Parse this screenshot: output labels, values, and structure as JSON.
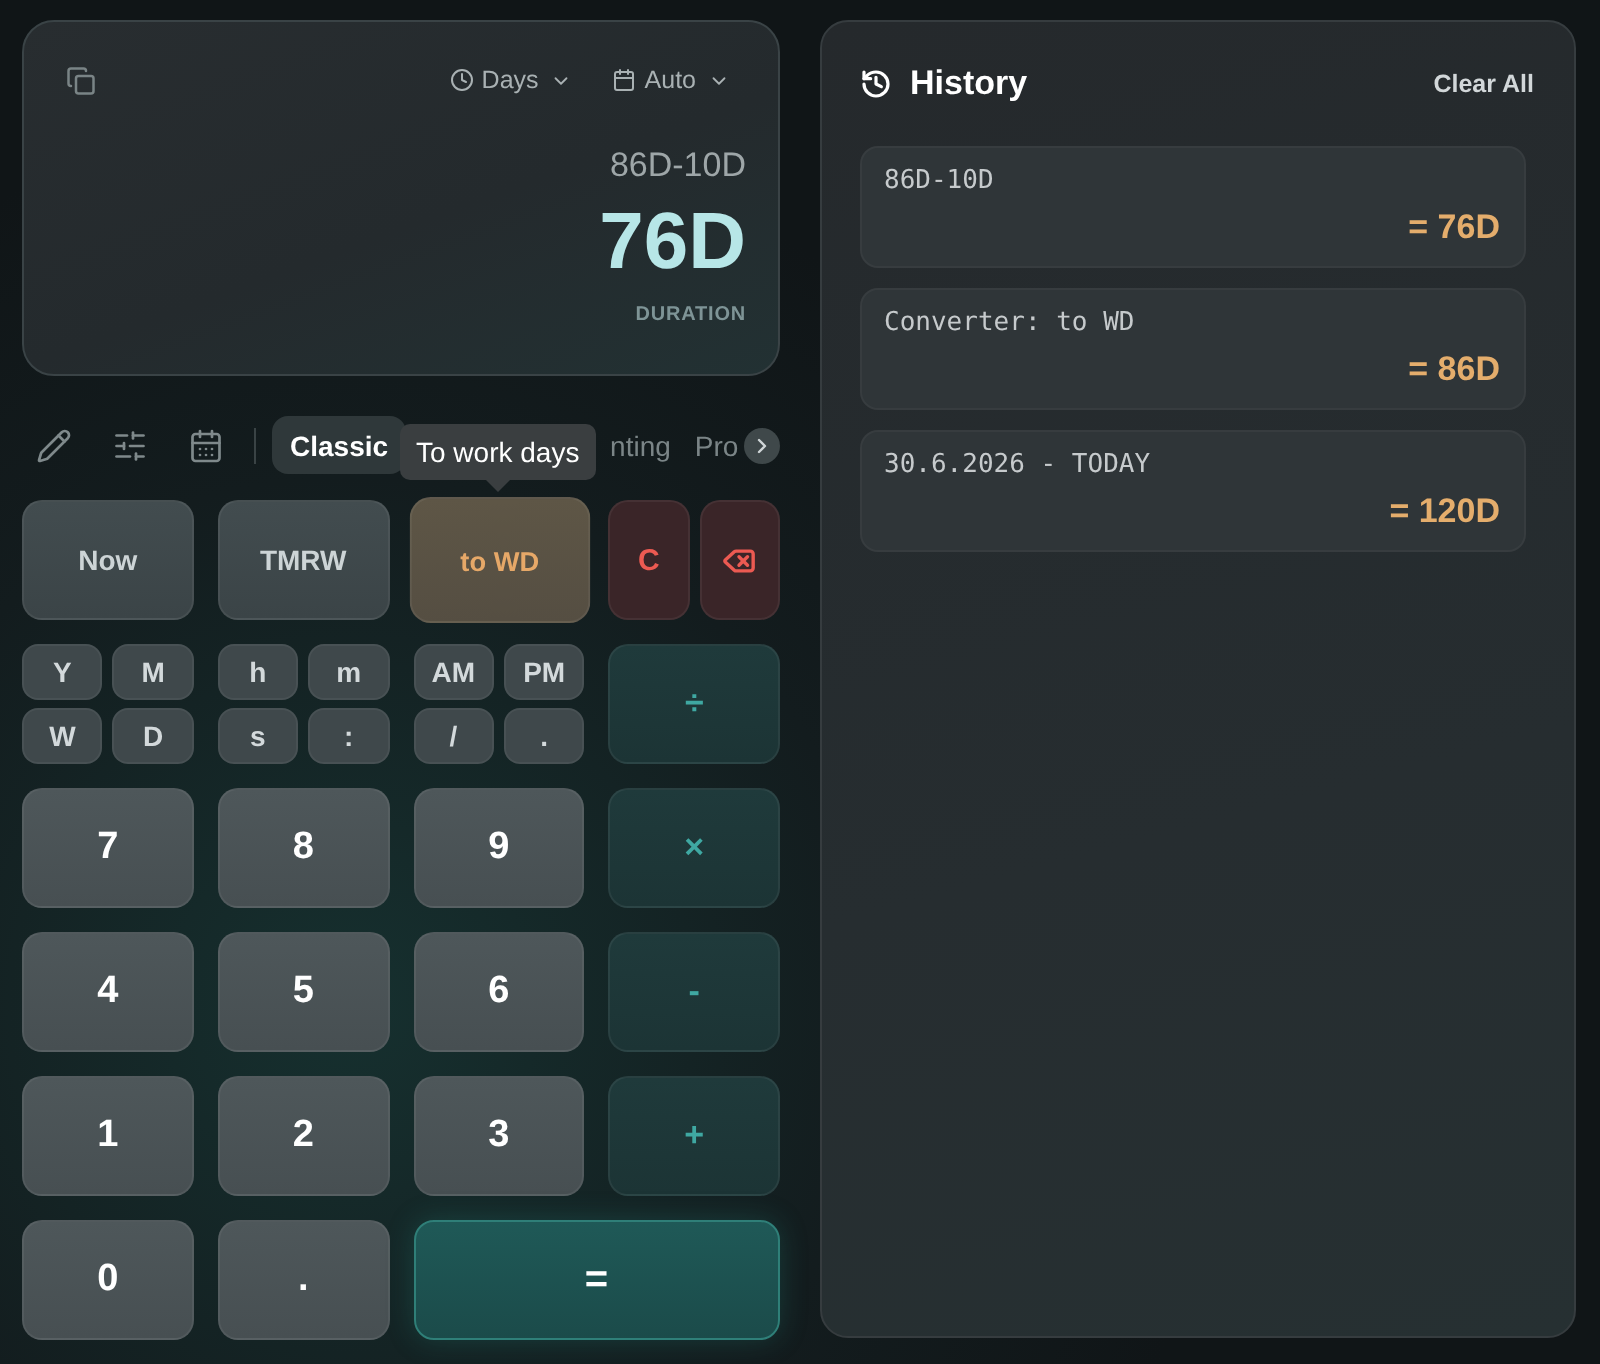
{
  "display": {
    "menus": [
      {
        "label": "Days",
        "kind": "clock"
      },
      {
        "label": "Auto",
        "kind": "calendar"
      }
    ],
    "expression": "86D-10D",
    "result": "76D",
    "result_label": "DURATION"
  },
  "toolbar": {
    "tabs": [
      {
        "label": "Classic",
        "selected": true
      },
      {
        "label": "nting",
        "selected": false
      },
      {
        "label": "Pro",
        "selected": false
      }
    ],
    "tooltip": "To work days"
  },
  "keypad": {
    "top_row": [
      {
        "label": "Now",
        "kind": "function"
      },
      {
        "label": "TMRW",
        "kind": "function"
      },
      {
        "label": "to WD",
        "kind": "convert"
      },
      {
        "label": "C",
        "kind": "clear"
      },
      {
        "kind": "backspace"
      }
    ],
    "unit_groups": [
      {
        "keys": [
          "Y",
          "M",
          "W",
          "D"
        ]
      },
      {
        "keys": [
          "h",
          "m",
          "s",
          ":"
        ]
      },
      {
        "keys": [
          "AM",
          "PM",
          "/",
          "."
        ]
      }
    ],
    "keys": [
      {
        "label": "÷",
        "kind": "operator"
      },
      {
        "label": "7",
        "kind": "digit"
      },
      {
        "label": "8",
        "kind": "digit"
      },
      {
        "label": "9",
        "kind": "digit"
      },
      {
        "label": "×",
        "kind": "operator"
      },
      {
        "label": "4",
        "kind": "digit"
      },
      {
        "label": "5",
        "kind": "digit"
      },
      {
        "label": "6",
        "kind": "digit"
      },
      {
        "label": "-",
        "kind": "operator"
      },
      {
        "label": "1",
        "kind": "digit"
      },
      {
        "label": "2",
        "kind": "digit"
      },
      {
        "label": "3",
        "kind": "digit"
      },
      {
        "label": "+",
        "kind": "operator"
      },
      {
        "label": "0",
        "kind": "digit"
      },
      {
        "label": ".",
        "kind": "digit"
      },
      {
        "label": "=",
        "kind": "equals"
      }
    ]
  },
  "history": {
    "title": "History",
    "clear_label": "Clear All",
    "entries": [
      {
        "expression": "86D-10D",
        "result": "= 76D"
      },
      {
        "expression": "Converter: to WD",
        "result": "= 86D"
      },
      {
        "expression": "30.6.2026 - TODAY",
        "result": "= 120D"
      }
    ]
  }
}
